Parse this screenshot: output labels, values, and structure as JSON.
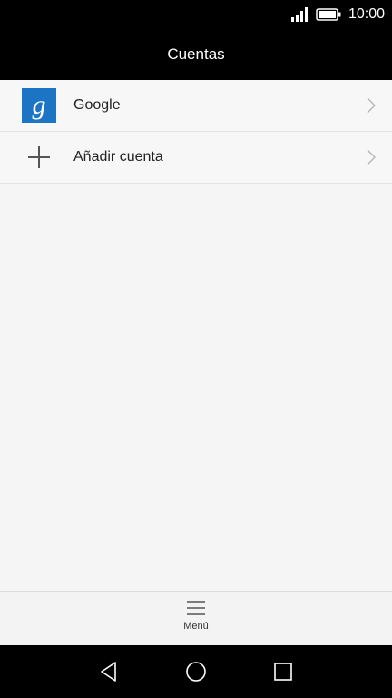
{
  "status_bar": {
    "time": "10:00",
    "icons": [
      "signal-icon",
      "battery-icon"
    ]
  },
  "header": {
    "title": "Cuentas"
  },
  "accounts": {
    "items": [
      {
        "label": "Google",
        "icon": "google-icon",
        "icon_glyph": "g",
        "icon_color": "#1b74c4"
      },
      {
        "label": "Añadir cuenta",
        "icon": "plus-icon"
      }
    ]
  },
  "bottom_menu": {
    "label": "Menú",
    "icon": "menu-icon"
  },
  "nav_bar": {
    "icons": [
      "back-icon",
      "home-icon",
      "recents-icon"
    ]
  }
}
